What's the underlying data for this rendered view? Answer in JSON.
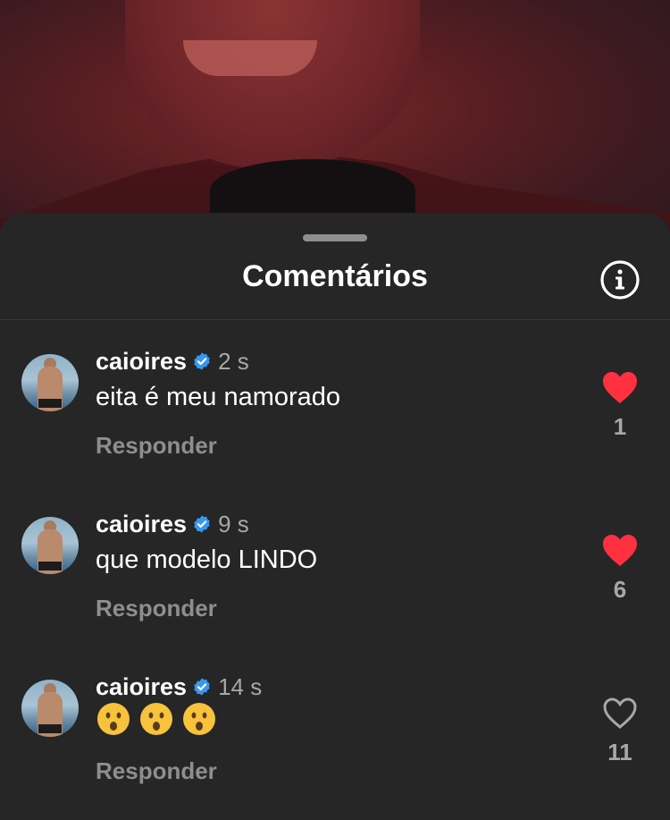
{
  "sheet": {
    "title": "Comentários"
  },
  "comments": [
    {
      "username": "caioires",
      "time": "2 s",
      "text": "eita é meu namorado",
      "reply_label": "Responder",
      "likes": "1",
      "liked": true
    },
    {
      "username": "caioires",
      "time": "9 s",
      "text": "que modelo LINDO",
      "reply_label": "Responder",
      "likes": "6",
      "liked": true
    },
    {
      "username": "caioires",
      "time": "14 s",
      "text": "😮😮😮",
      "reply_label": "Responder",
      "likes": "11",
      "liked": false
    }
  ],
  "colors": {
    "like_active": "#ff3040",
    "verified": "#3897f0",
    "sheet_bg": "#262626"
  },
  "icons": [
    "info-icon",
    "verified-badge-icon",
    "heart-filled-icon",
    "heart-outline-icon",
    "surprised-face-emoji"
  ]
}
